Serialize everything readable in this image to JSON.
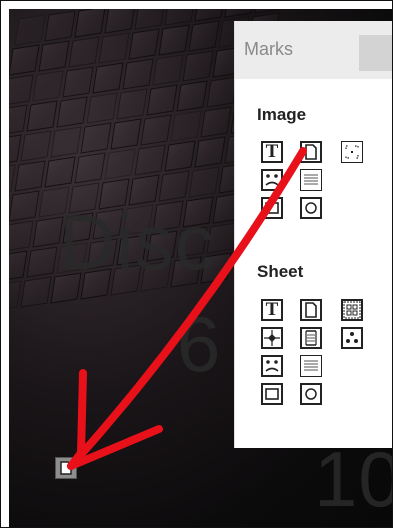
{
  "background": {
    "text_1": "Disc",
    "text_2": "6",
    "text_3": "10"
  },
  "panel": {
    "title": "Marks",
    "image_section_label": "Image",
    "sheet_section_label": "Sheet",
    "image_tools": [
      {
        "icon": "text-tool-icon"
      },
      {
        "icon": "page-tool-icon"
      },
      {
        "icon": "crop-corners-tool-icon"
      },
      {
        "icon": "face-tool-icon"
      },
      {
        "icon": "lines-tool-icon"
      },
      {
        "icon": "rectangle-tool-icon"
      },
      {
        "icon": "ellipse-tool-icon"
      }
    ],
    "sheet_tools": [
      {
        "icon": "text-tool-icon"
      },
      {
        "icon": "page-tool-icon"
      },
      {
        "icon": "grid-tool-icon"
      },
      {
        "icon": "crosshair-tool-icon"
      },
      {
        "icon": "split-lines-tool-icon"
      },
      {
        "icon": "dots-tool-icon"
      },
      {
        "icon": "face-tool-icon"
      },
      {
        "icon": "lines-tool-icon"
      },
      {
        "icon": "rectangle-tool-icon"
      },
      {
        "icon": "ellipse-tool-icon"
      }
    ],
    "text_glyph": "T"
  },
  "annotation": {
    "arrow_color": "#e8111a"
  }
}
